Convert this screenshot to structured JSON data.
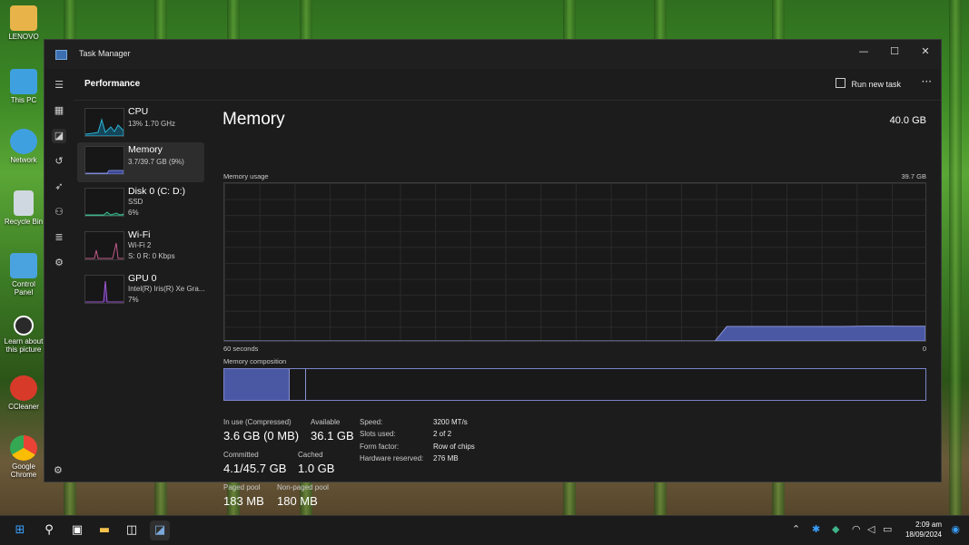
{
  "desktop": {
    "icons": [
      {
        "label": "LENOVO",
        "icon": "user-folder-icon",
        "color": "#e8b44a"
      },
      {
        "label": "This PC",
        "icon": "monitor-icon",
        "color": "#3fa0e0"
      },
      {
        "label": "Network",
        "icon": "network-icon",
        "color": "#3fa0e0"
      },
      {
        "label": "Recycle Bin",
        "icon": "recycle-bin-icon",
        "color": "#cfd8e0"
      },
      {
        "label": "Control Panel",
        "icon": "control-panel-icon",
        "color": "#4aa3df"
      },
      {
        "label": "Learn about this picture",
        "icon": "camera-icon",
        "color": "#2a2a2a"
      },
      {
        "label": "CCleaner",
        "icon": "ccleaner-icon",
        "color": "#d83a2a"
      },
      {
        "label": "Google Chrome",
        "icon": "chrome-icon",
        "color": "#34a853"
      }
    ]
  },
  "window": {
    "title": "Task Manager",
    "controls": {
      "minimize": "—",
      "maximize": "☐",
      "close": "✕"
    }
  },
  "header": {
    "title": "Performance",
    "run_new_task": "Run new task",
    "more": "···"
  },
  "sidebar": {
    "items": [
      {
        "name": "CPU",
        "line1": "13%  1.70 GHz",
        "line2": "",
        "color": "#2ab4d6"
      },
      {
        "name": "Memory",
        "line1": "3.7/39.7 GB (9%)",
        "line2": "",
        "color": "#7a86d6"
      },
      {
        "name": "Disk 0 (C: D:)",
        "line1": "SSD",
        "line2": "6%",
        "color": "#3fb38a"
      },
      {
        "name": "Wi-Fi",
        "line1": "Wi-Fi 2",
        "line2": "S: 0 R: 0 Kbps",
        "color": "#c25a8a"
      },
      {
        "name": "GPU 0",
        "line1": "Intel(R) Iris(R) Xe Gra...",
        "line2": "7%",
        "color": "#a05ad6"
      }
    ]
  },
  "main": {
    "title": "Memory",
    "total": "40.0 GB",
    "usage_label": "Memory usage",
    "usage_max": "39.7 GB",
    "axis_left": "60 seconds",
    "axis_right": "0",
    "composition_label": "Memory composition",
    "usage_series": [
      0,
      0,
      0,
      0,
      0,
      0,
      0,
      0,
      0,
      0,
      0,
      0,
      0,
      0,
      0,
      0,
      0,
      0,
      0,
      0,
      0,
      0,
      0,
      0,
      0,
      0,
      0,
      0,
      0,
      0,
      0,
      0,
      0,
      0,
      0,
      0,
      0,
      0,
      0,
      0,
      0,
      0,
      0,
      9.2,
      9.2,
      9.2,
      9.2,
      9.2,
      9.2,
      9.2,
      9.2,
      9.2,
      9.2,
      9.2,
      9.3,
      9.4,
      9.4,
      9.4,
      9.3,
      9.3,
      9.3
    ],
    "usage_series_max": 100,
    "stats": {
      "in_use_label": "In use (Compressed)",
      "in_use": "3.6 GB (0 MB)",
      "available_label": "Available",
      "available": "36.1 GB",
      "committed_label": "Committed",
      "committed": "4.1/45.7 GB",
      "cached_label": "Cached",
      "cached": "1.0 GB",
      "paged_label": "Paged pool",
      "paged": "183 MB",
      "nonpaged_label": "Non-paged pool",
      "nonpaged": "180 MB"
    },
    "details": [
      {
        "label": "Speed:",
        "value": "3200 MT/s"
      },
      {
        "label": "Slots used:",
        "value": "2 of 2"
      },
      {
        "label": "Form factor:",
        "value": "Row of chips"
      },
      {
        "label": "Hardware reserved:",
        "value": "276 MB"
      }
    ]
  },
  "taskbar": {
    "time": "2:09 am",
    "date": "18/09/2024",
    "accent": "#3aa0ff"
  }
}
